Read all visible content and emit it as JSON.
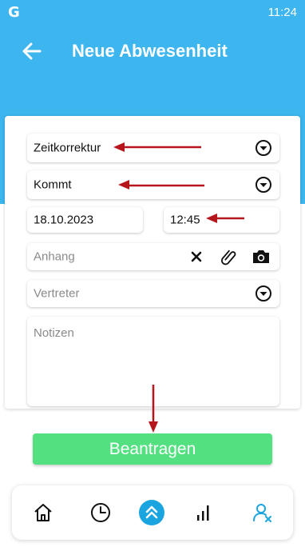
{
  "status_bar": {
    "logo": "G",
    "time": "11:24"
  },
  "header": {
    "title": "Neue Abwesenheit"
  },
  "form": {
    "type_value": "Zeitkorrektur",
    "direction_value": "Kommt",
    "date_value": "18.10.2023",
    "time_value": "12:45",
    "attachment_placeholder": "Anhang",
    "substitute_placeholder": "Vertreter",
    "notes_placeholder": "Notizen"
  },
  "submit_label": "Beantragen",
  "bottom_nav": {
    "items": [
      "home-icon",
      "clock-icon",
      "chevron-double-up-icon",
      "chart-bars-icon",
      "user-remove-icon"
    ]
  },
  "colors": {
    "header": "#3db5ee",
    "submit": "#52e081",
    "annotation_arrow": "#b5161c",
    "nav_active": "#1aa5e0"
  }
}
